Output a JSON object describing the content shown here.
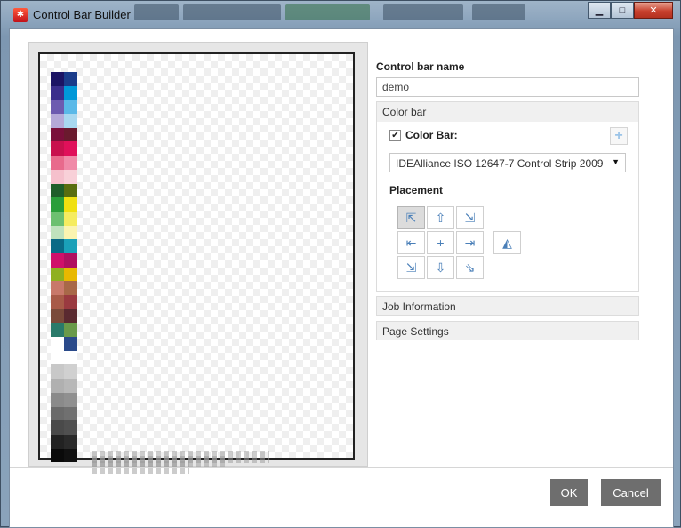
{
  "window": {
    "title": "Control Bar Builder",
    "app_icon": "app-logo-icon",
    "buttons": {
      "minimize": "minimize-icon",
      "maximize": "maximize-icon",
      "close": "close-icon"
    }
  },
  "form": {
    "name_label": "Control bar name",
    "name_value": "demo"
  },
  "sections": {
    "color_bar": {
      "title": "Color bar",
      "checkbox_label": "Color Bar:",
      "checked": true,
      "add_icon": "plus-icon",
      "selected_strip": "IDEAlliance ISO 12647-7 Control Strip 2009",
      "placement_label": "Placement",
      "selected_placement": "top-left"
    },
    "job_information": {
      "title": "Job Information"
    },
    "page_settings": {
      "title": "Page Settings"
    }
  },
  "footer": {
    "ok_label": "OK",
    "cancel_label": "Cancel"
  },
  "colors": {
    "button_bg": "#6e6e6e",
    "accent_icon": "#4a7fb8",
    "section_bg": "#f0f0f0"
  }
}
